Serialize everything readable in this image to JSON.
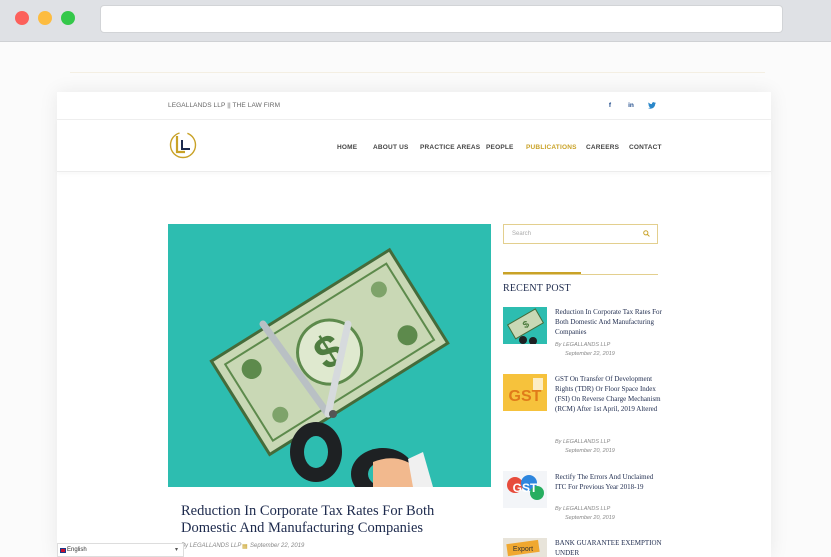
{
  "site": {
    "tagline": "LEGALLANDS LLP || THE LAW FIRM",
    "nav": [
      "HOME",
      "ABOUT US",
      "PRACTICE AREAS",
      "PEOPLE",
      "PUBLICATIONS",
      "CAREERS",
      "CONTACT"
    ],
    "active_nav": "PUBLICATIONS",
    "accent": "#c9a227",
    "title_color": "#1d2a4d"
  },
  "post": {
    "title": "Reduction In Corporate Tax Rates For Both Domestic And Manufacturing Companies",
    "author": "By LEGALLANDS LLP",
    "date": "September 22, 2019"
  },
  "sidebar": {
    "search_placeholder": "Search",
    "recent_title": "RECENT POST",
    "posts": [
      {
        "title": "Reduction In Corporate Tax Rates For Both Domestic And Manufacturing Companies",
        "author": "By LEGALLANDS LLP",
        "date": "September 22, 2019"
      },
      {
        "title": "GST On Transfer Of Development Rights (TDR) Or Floor Space Index (FSI) On Reverse Charge Mechanism (RCM) After 1st April, 2019 Altered",
        "author": "By LEGALLANDS LLP",
        "date": "September 20, 2019"
      },
      {
        "title": "Rectify The Errors And Unclaimed ITC For Previous Year 2018-19",
        "author": "By LEGALLANDS LLP",
        "date": "September 20, 2019"
      },
      {
        "title": "BANK GUARANTEE EXEMPTION UNDER",
        "author": "",
        "date": ""
      }
    ]
  },
  "language": {
    "label": "English"
  }
}
